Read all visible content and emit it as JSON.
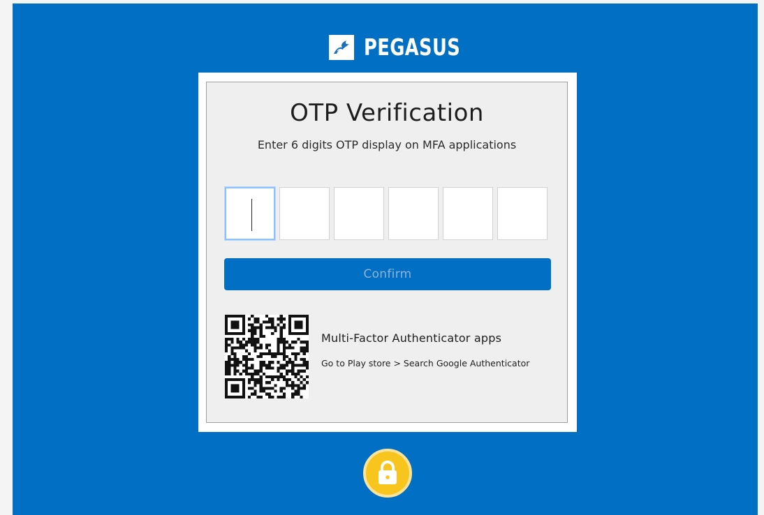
{
  "brand": {
    "name": "PEGASUS"
  },
  "otp": {
    "title": "OTP Verification",
    "subtitle": "Enter 6 digits OTP display on MFA applications",
    "digits": [
      "",
      "",
      "",
      "",
      "",
      ""
    ],
    "active_index": 0,
    "confirm_label": "Confirm"
  },
  "mfa": {
    "title": "Multi-Factor Authenticator apps",
    "hint": "Go to Play store > Search Google Authenticator"
  },
  "colors": {
    "background_blue": "#0170c4",
    "card": "#efefef",
    "lock_yellow": "#f7c51d"
  },
  "icons": {
    "brand": "pegasus-logo-icon",
    "qr": "qr-code-icon",
    "lock": "lock-icon"
  }
}
